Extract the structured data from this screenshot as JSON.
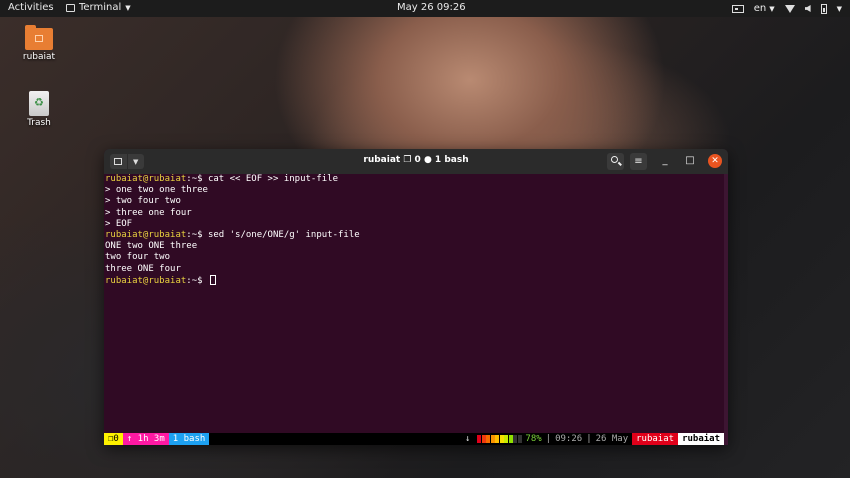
{
  "topbar": {
    "activities": "Activities",
    "app_name": "Terminal",
    "clock": "May 26  09:26",
    "lang": "en"
  },
  "desktop": {
    "icons": [
      {
        "label": "rubaiat",
        "icon": "home-folder-icon"
      },
      {
        "label": "Trash",
        "icon": "trash-icon"
      }
    ]
  },
  "terminal": {
    "title": "rubaiat ❐ 0 ● 1 bash",
    "lines": [
      {
        "user": "rubaiat@rubaiat",
        "rest": ":~$ cat << EOF >> input-file"
      },
      {
        "text": "> one two one three"
      },
      {
        "text": "> two four two"
      },
      {
        "text": "> three one four"
      },
      {
        "text": "> EOF"
      },
      {
        "user": "rubaiat@rubaiat",
        "rest": ":~$ sed 's/one/ONE/g' input-file"
      },
      {
        "text": "ONE two ONE three"
      },
      {
        "text": "two four two"
      },
      {
        "text": "three ONE four"
      },
      {
        "user": "rubaiat@rubaiat",
        "rest": ":~$ "
      }
    ],
    "status": {
      "session": "❐0",
      "uptime": "↑ 1h 3m",
      "window": "1 bash",
      "arrow": "↓",
      "battery_percent": "78%",
      "battery_level": 0.78,
      "time": "09:26",
      "date": "26 May",
      "host": "rubaiat",
      "user": "rubaiat",
      "separator": "|"
    }
  },
  "colors": {
    "terminal_bg": "#300a24",
    "prompt_user": "#e8d03f",
    "close_button": "#e95420"
  }
}
